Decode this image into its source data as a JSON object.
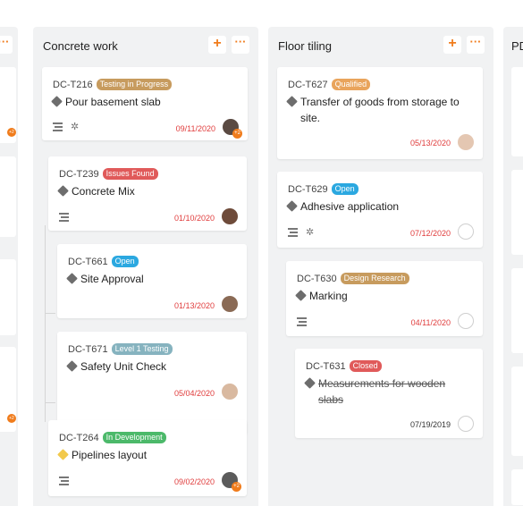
{
  "columns": [
    {
      "title": "Concrete work",
      "cards": [
        {
          "id": "DC-T216",
          "badge": "Testing in Progress",
          "badge_color": "#c79b5e",
          "title": "Pour basement slab",
          "date": "09/11/2020",
          "avatar_count": "+2"
        },
        {
          "id": "DC-T239",
          "badge": "Issues Found",
          "badge_color": "#e05a5a",
          "title": "Concrete Mix",
          "date": "01/10/2020"
        },
        {
          "id": "DC-T661",
          "badge": "Open",
          "badge_color": "#2ba8e0",
          "title": "Site Approval",
          "date": "01/13/2020"
        },
        {
          "id": "DC-T671",
          "badge": "Level 1 Testing",
          "badge_color": "#86b3bf",
          "title": "Safety Unit Check",
          "date": "05/04/2020"
        },
        {
          "id": "DC-T264",
          "badge": "In Development",
          "badge_color": "#4cb96a",
          "title": "Pipelines layout",
          "date": "09/02/2020",
          "avatar_count": "+2"
        }
      ]
    },
    {
      "title": "Floor tiling",
      "cards": [
        {
          "id": "DC-T627",
          "badge": "Qualified",
          "badge_color": "#e9a45c",
          "title": "Transfer of goods from storage to site.",
          "date": "05/13/2020"
        },
        {
          "id": "DC-T629",
          "badge": "Open",
          "badge_color": "#2ba8e0",
          "title": "Adhesive application",
          "date": "07/12/2020"
        },
        {
          "id": "DC-T630",
          "badge": "Design Research",
          "badge_color": "#c79b5e",
          "title": "Marking",
          "date": "04/11/2020"
        },
        {
          "id": "DC-T631",
          "badge": "Closed",
          "badge_color": "#e05a5a",
          "title": "Measurements for wooden slabs",
          "date": "07/19/2019"
        }
      ]
    }
  ],
  "right_column_title": "PD",
  "actions": {
    "add": "+",
    "more": "···"
  },
  "left_edge_counts": [
    "+2",
    "+2"
  ],
  "colors": {
    "accent": "#f07c1c",
    "overdue": "#e03c3c"
  }
}
